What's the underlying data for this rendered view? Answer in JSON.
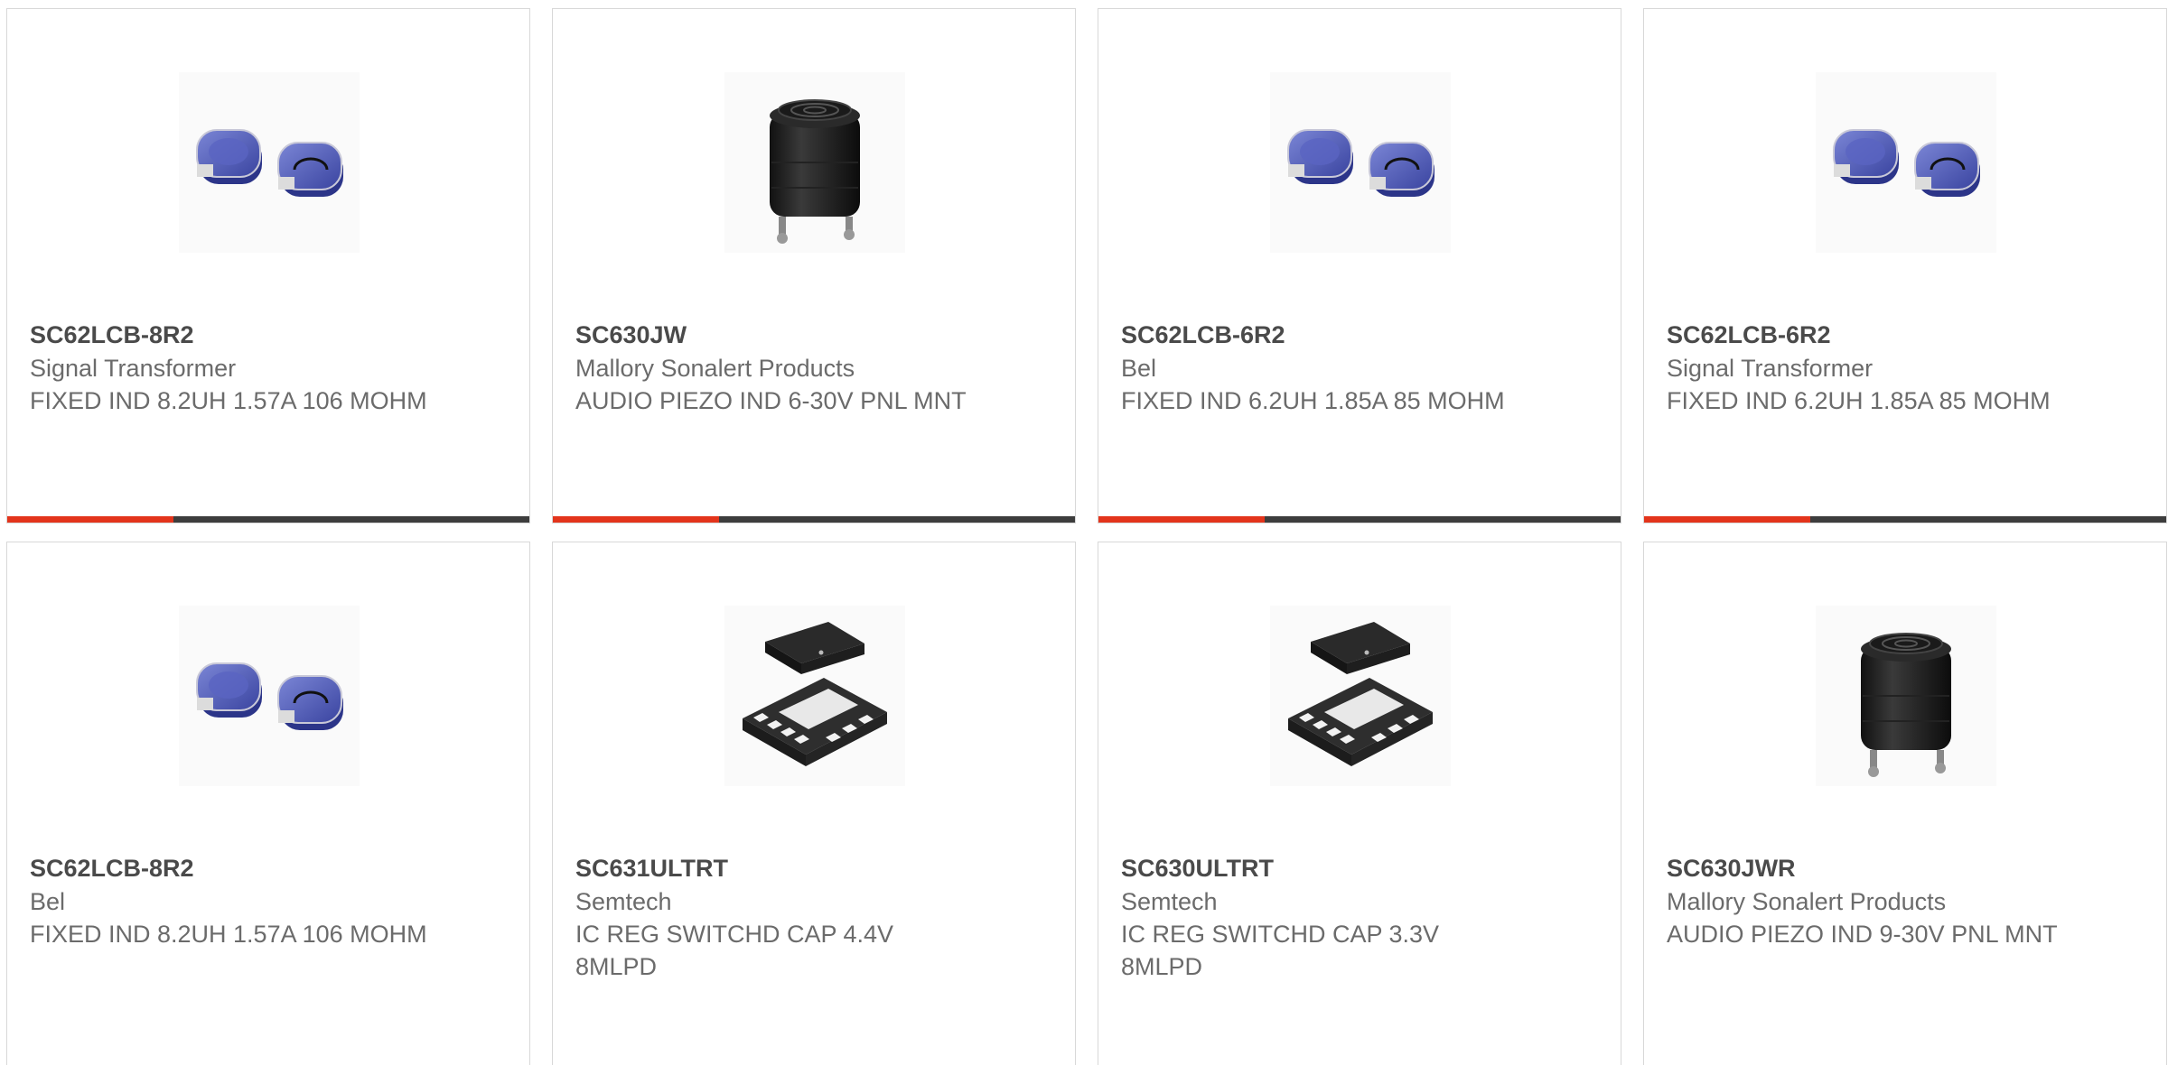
{
  "colors": {
    "accent": "#e3341b",
    "bar": "#3d3d3d",
    "border": "#d8d8d8",
    "part_number": "#4a4a4a",
    "text": "#6b6b6b"
  },
  "cards": [
    {
      "part_number": "SC62LCB-8R2",
      "manufacturer": "Signal Transformer",
      "description": "FIXED IND 8.2UH 1.57A 106 MOHM",
      "image_icon": "inductor-pair-icon"
    },
    {
      "part_number": "SC630JW",
      "manufacturer": "Mallory Sonalert Products",
      "description": "AUDIO PIEZO IND 6-30V PNL MNT",
      "image_icon": "piezo-buzzer-icon"
    },
    {
      "part_number": "SC62LCB-6R2",
      "manufacturer": "Bel",
      "description": "FIXED IND 6.2UH 1.85A 85 MOHM",
      "image_icon": "inductor-pair-icon"
    },
    {
      "part_number": "SC62LCB-6R2",
      "manufacturer": "Signal Transformer",
      "description": "FIXED IND 6.2UH 1.85A 85 MOHM",
      "image_icon": "inductor-pair-icon"
    },
    {
      "part_number": "SC62LCB-8R2",
      "manufacturer": "Bel",
      "description": "FIXED IND 8.2UH 1.57A 106 MOHM",
      "image_icon": "inductor-pair-icon"
    },
    {
      "part_number": "SC631ULTRT",
      "manufacturer": "Semtech",
      "description": "IC REG SWITCHD CAP 4.4V 8MLPD",
      "image_icon": "ic-package-icon"
    },
    {
      "part_number": "SC630ULTRT",
      "manufacturer": "Semtech",
      "description": "IC REG SWITCHD CAP 3.3V 8MLPD",
      "image_icon": "ic-package-icon"
    },
    {
      "part_number": "SC630JWR",
      "manufacturer": "Mallory Sonalert Products",
      "description": "AUDIO PIEZO IND 9-30V PNL MNT",
      "image_icon": "piezo-buzzer-icon"
    }
  ]
}
